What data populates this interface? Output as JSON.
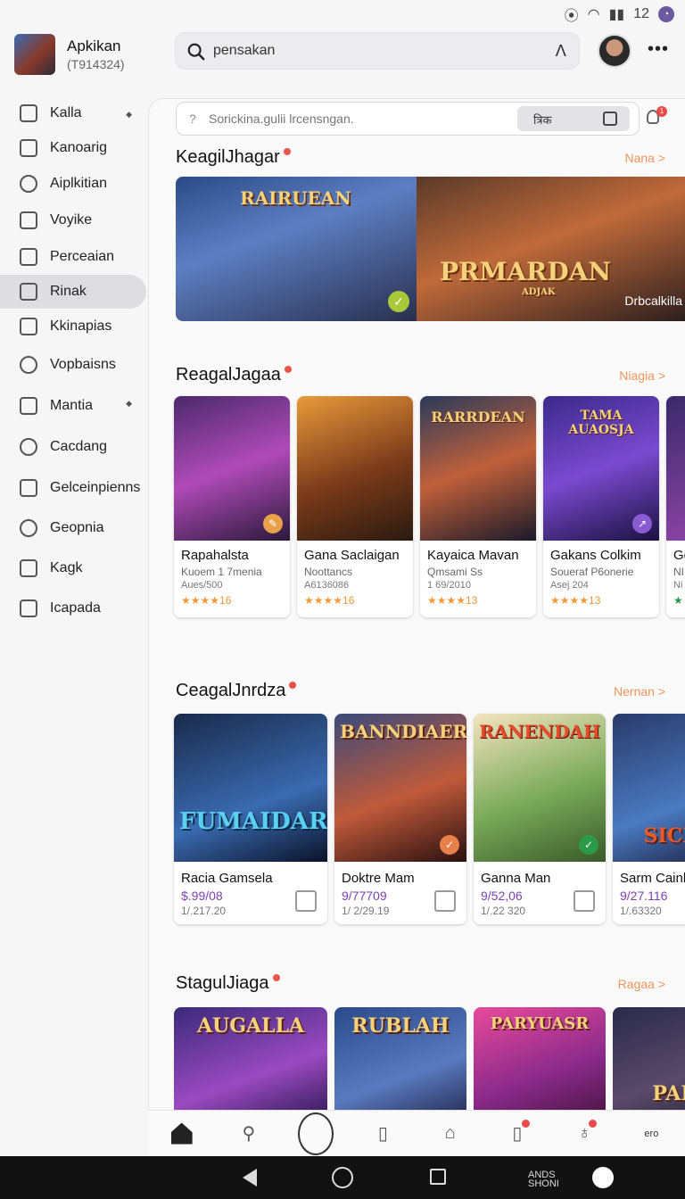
{
  "status": {
    "time": "12"
  },
  "header": {
    "app_name": "Apkikan",
    "app_sub": "(T914324)",
    "search_value": "pensakan",
    "more_label": "•••"
  },
  "sidebar": {
    "items": [
      {
        "label": "Kalla"
      },
      {
        "label": "Kanoarig"
      },
      {
        "label": "Aiplkitian"
      },
      {
        "label": "Voyike"
      },
      {
        "label": "Perceaian"
      },
      {
        "label": "Rinak"
      },
      {
        "label": "Kkinapias"
      },
      {
        "label": "Vopbaisns"
      },
      {
        "label": "Mantia"
      },
      {
        "label": "Cacdang"
      },
      {
        "label": "Gelceinpienns"
      },
      {
        "label": "Geopnia"
      },
      {
        "label": "Kagk"
      },
      {
        "label": "Icapada"
      }
    ]
  },
  "main": {
    "subsearch_placeholder": "Sorickina.gulii lrcensngan.",
    "filter_label": "त्रिक",
    "bell_count": "1",
    "sections": [
      {
        "title": "KeagilJhagar",
        "link": "Nana >"
      },
      {
        "title": "ReagalJagaa",
        "link": "Niagia >"
      },
      {
        "title": "CeagalJnrdza",
        "link": "Nernan >"
      },
      {
        "title": "StagulJiaga",
        "link": "Ragaa >"
      }
    ],
    "banner": {
      "left_title": "RAIRUEAN",
      "right_title": "PRMARDAN",
      "right_subtitle": "ADJAK",
      "right_tag": "Drbcalkilla"
    },
    "row1": [
      {
        "name": "Rapahalsta",
        "meta1": "Kuoem 1 7menia",
        "meta2": "Aues/500",
        "stars": "★★★★16",
        "art_title": ""
      },
      {
        "name": "Gana Saclaigan",
        "meta1": "Noottancs",
        "meta2": "A6136086",
        "stars": "★★★★16",
        "art_title": ""
      },
      {
        "name": "Kayaica Mavan",
        "meta1": "Qmsami Ss",
        "meta2": "1 69/2010",
        "stars": "★★★★13",
        "art_title": "RARRDEAN"
      },
      {
        "name": "Gakans Colkim",
        "meta1": "Soueraf P6onerie",
        "meta2": "Asej 204",
        "stars": "★★★★13",
        "art_title": "TAMA AUAOSJA"
      },
      {
        "name": "Go",
        "meta1": "NI",
        "meta2": "Ni",
        "stars": "★",
        "art_title": ""
      }
    ],
    "row2": [
      {
        "name": "Racia Gamsela",
        "price": "$.99/08",
        "date": "1/.217.20",
        "art_title": "FUMAIDAR"
      },
      {
        "name": "Doktre Mam",
        "price": "9/77709",
        "date": "1/ 2/29.19",
        "art_title": "BANNDIAER"
      },
      {
        "name": "Ganna Man",
        "price": "9/52,06",
        "date": "1/.22 320",
        "art_title": "RANENDAH"
      },
      {
        "name": "Sarm Cainl",
        "price": "9/27.116",
        "date": "1/.63320",
        "art_title": "SICEB"
      }
    ],
    "row3": [
      {
        "art_title": "AUGALLA"
      },
      {
        "art_title": "RUBLAH"
      },
      {
        "art_title": "PARYUASR"
      },
      {
        "art_title": "PAIA"
      }
    ]
  },
  "tabbar": {
    "last_label": "ero"
  },
  "navbar": {
    "text_line1": "ANDS",
    "text_line2": "SHONI"
  }
}
